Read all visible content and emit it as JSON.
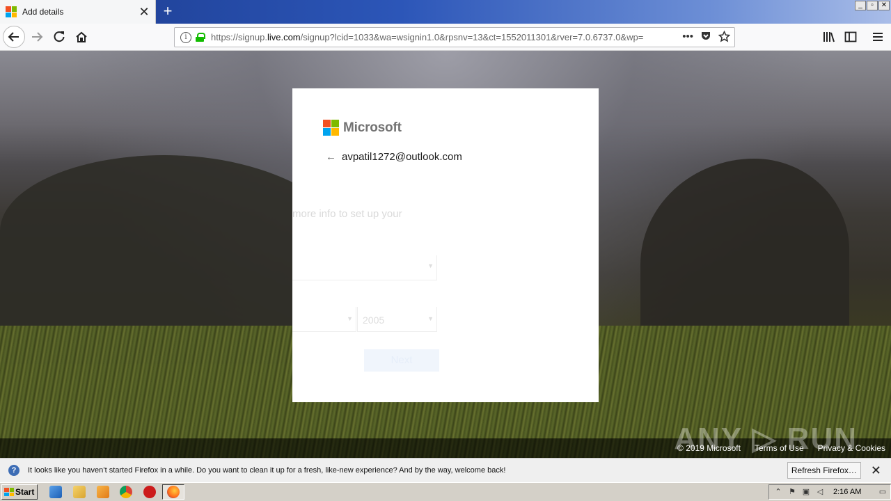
{
  "browser": {
    "tab": {
      "title": "Add details",
      "close_glyph": "✕"
    },
    "new_tab_glyph": "+",
    "window_buttons": [
      "_",
      "▫",
      "✕"
    ],
    "url": {
      "prefix": "https://signup.",
      "domain": "live.com",
      "rest": "/signup?lcid=1033&wa=wsignin1.0&rpsnv=13&ct=1552011301&rver=7.0.6737.0&wp="
    },
    "url_actions": [
      "•••",
      "pocket-icon",
      "star-icon"
    ]
  },
  "card": {
    "brand": "Microsoft",
    "brand_colors": [
      "#f25022",
      "#7fba00",
      "#00a4ef",
      "#ffb900"
    ],
    "back_arrow": "←",
    "email": "avpatil1272@outlook.com",
    "fading_heading": "more info to set up your",
    "year_value": "2005",
    "next_label": "Next"
  },
  "footer": {
    "copyright": "© 2019 Microsoft",
    "terms": "Terms of Use",
    "privacy": "Privacy & Cookies",
    "watermark": "ANY ▷ RUN"
  },
  "notification": {
    "text": "It looks like you haven’t started Firefox in a while. Do you want to clean it up for a fresh, like-new experience? And by the way, welcome back!",
    "button": "Refresh Firefox…",
    "close_glyph": "✕"
  },
  "taskbar": {
    "start_label": "Start",
    "clock": "2:16 AM"
  }
}
